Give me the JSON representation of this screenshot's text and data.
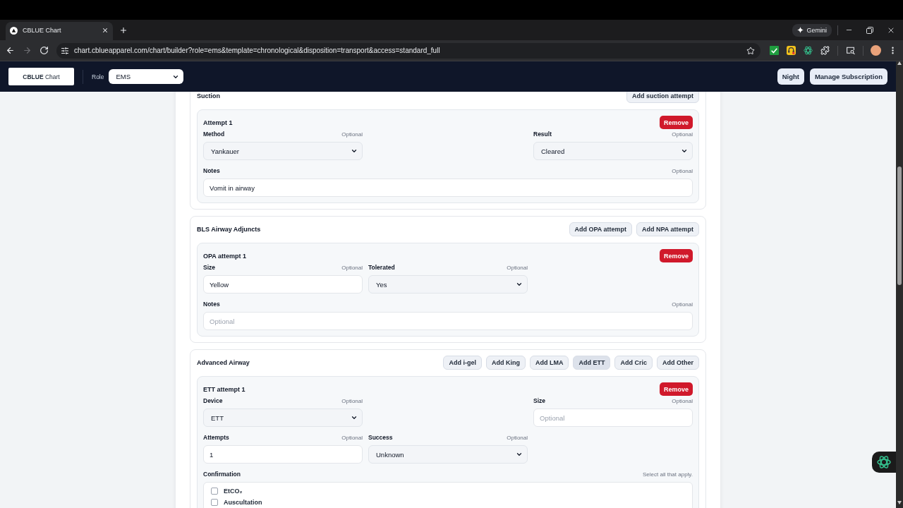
{
  "browser": {
    "tabs": [
      {
        "title": "CBLUE Chart",
        "selected": true
      }
    ],
    "gemini": "Gemini",
    "nav": [
      {
        "kind": "back",
        "disabled": false
      },
      {
        "kind": "forward",
        "disabled": true
      },
      {
        "kind": "reload",
        "disabled": false
      }
    ],
    "url": "chart.cblueapparel.com/chart/builder?role=ems&template=chronological&disposition=transport&access=standard_full"
  },
  "header": {
    "logo": "**CBLUE** Chart",
    "role_label": "Role",
    "role": "EMS",
    "buttons": [
      "Night",
      "Manage Subscription"
    ]
  },
  "sections": [
    {
      "title": "Suction",
      "actions": [
        {
          "label": "Add suction attempt",
          "focused": false
        }
      ],
      "attempts": [
        {
          "title": "Attempt 1",
          "remove": "Remove",
          "rows": [
            [
              {
                "kind": "select",
                "label": "Method",
                "note": "Optional",
                "value": "Yankauer"
              },
              null,
              {
                "kind": "select",
                "label": "Result",
                "note": "Optional",
                "value": "Cleared"
              }
            ],
            [
              {
                "kind": "input",
                "label": "Notes",
                "note": "Optional",
                "value": "Vomit in airway"
              }
            ]
          ]
        }
      ]
    },
    {
      "title": "BLS Airway Adjuncts",
      "actions": [
        {
          "label": "Add OPA attempt",
          "focused": false
        },
        {
          "label": "Add NPA attempt",
          "focused": false
        }
      ],
      "attempts": [
        {
          "title": "OPA attempt 1",
          "remove": "Remove",
          "rows": [
            [
              {
                "kind": "input",
                "label": "Size",
                "note": "Optional",
                "value": "Yellow"
              },
              {
                "kind": "select",
                "label": "Tolerated",
                "note": "Optional",
                "value": "Yes"
              },
              null
            ],
            [
              {
                "kind": "input",
                "label": "Notes",
                "note": "Optional",
                "placeholder": "Optional"
              }
            ]
          ]
        }
      ]
    },
    {
      "title": "Advanced Airway",
      "actions": [
        {
          "label": "Add i-gel",
          "focused": false
        },
        {
          "label": "Add King",
          "focused": false
        },
        {
          "label": "Add LMA",
          "focused": false
        },
        {
          "label": "Add ETT",
          "focused": true
        },
        {
          "label": "Add Cric",
          "focused": false
        },
        {
          "label": "Add Other",
          "focused": false
        }
      ],
      "attempts": [
        {
          "title": "ETT attempt 1",
          "remove": "Remove",
          "rows": [
            [
              {
                "kind": "select",
                "label": "Device",
                "note": "Optional",
                "value": "ETT"
              },
              null,
              {
                "kind": "input",
                "label": "Size",
                "note": "Optional",
                "placeholder": "Optional"
              }
            ],
            [
              {
                "kind": "input",
                "label": "Attempts",
                "note": "Optional",
                "value": "1"
              },
              {
                "kind": "select",
                "label": "Success",
                "note": "Optional",
                "value": "Unknown"
              },
              null
            ],
            [
              {
                "kind": "checklist",
                "label": "Confirmation",
                "note": "Select all that apply.",
                "options": [
                  {
                    "label": "EtCO₂",
                    "checked": false
                  },
                  {
                    "label": "Auscultation",
                    "checked": false
                  }
                ]
              }
            ]
          ]
        }
      ]
    }
  ]
}
